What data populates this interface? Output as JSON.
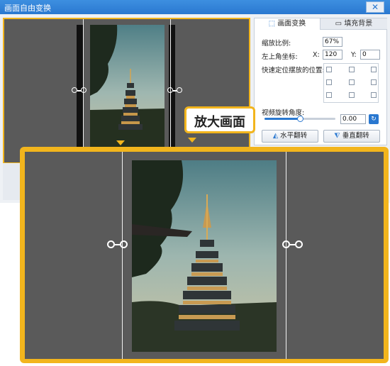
{
  "window": {
    "title": "画面自由变换",
    "close_label": "✕"
  },
  "tabs": [
    {
      "label": "画面变换"
    },
    {
      "label": "填充背景"
    }
  ],
  "zoom_field": {
    "label": "缩放比例:",
    "value": "67%"
  },
  "position": {
    "label": "左上角坐标:",
    "x_label": "X:",
    "x_value": "120",
    "y_label": "Y:",
    "y_value": "0"
  },
  "quick_position": {
    "label": "快速定位摆放的位置:"
  },
  "rotation": {
    "label": "视频旋转角度:",
    "value": "0.00",
    "slider_fraction": 0.5
  },
  "buttons": {
    "flip_horizontal": "水平翻转",
    "flip_vertical": "垂直翻转"
  },
  "callout": {
    "text": "放大画面"
  },
  "colors": {
    "accent": "#f2b51d",
    "title_bar": "#2a78d0",
    "canvas": "#5a5a5a"
  }
}
